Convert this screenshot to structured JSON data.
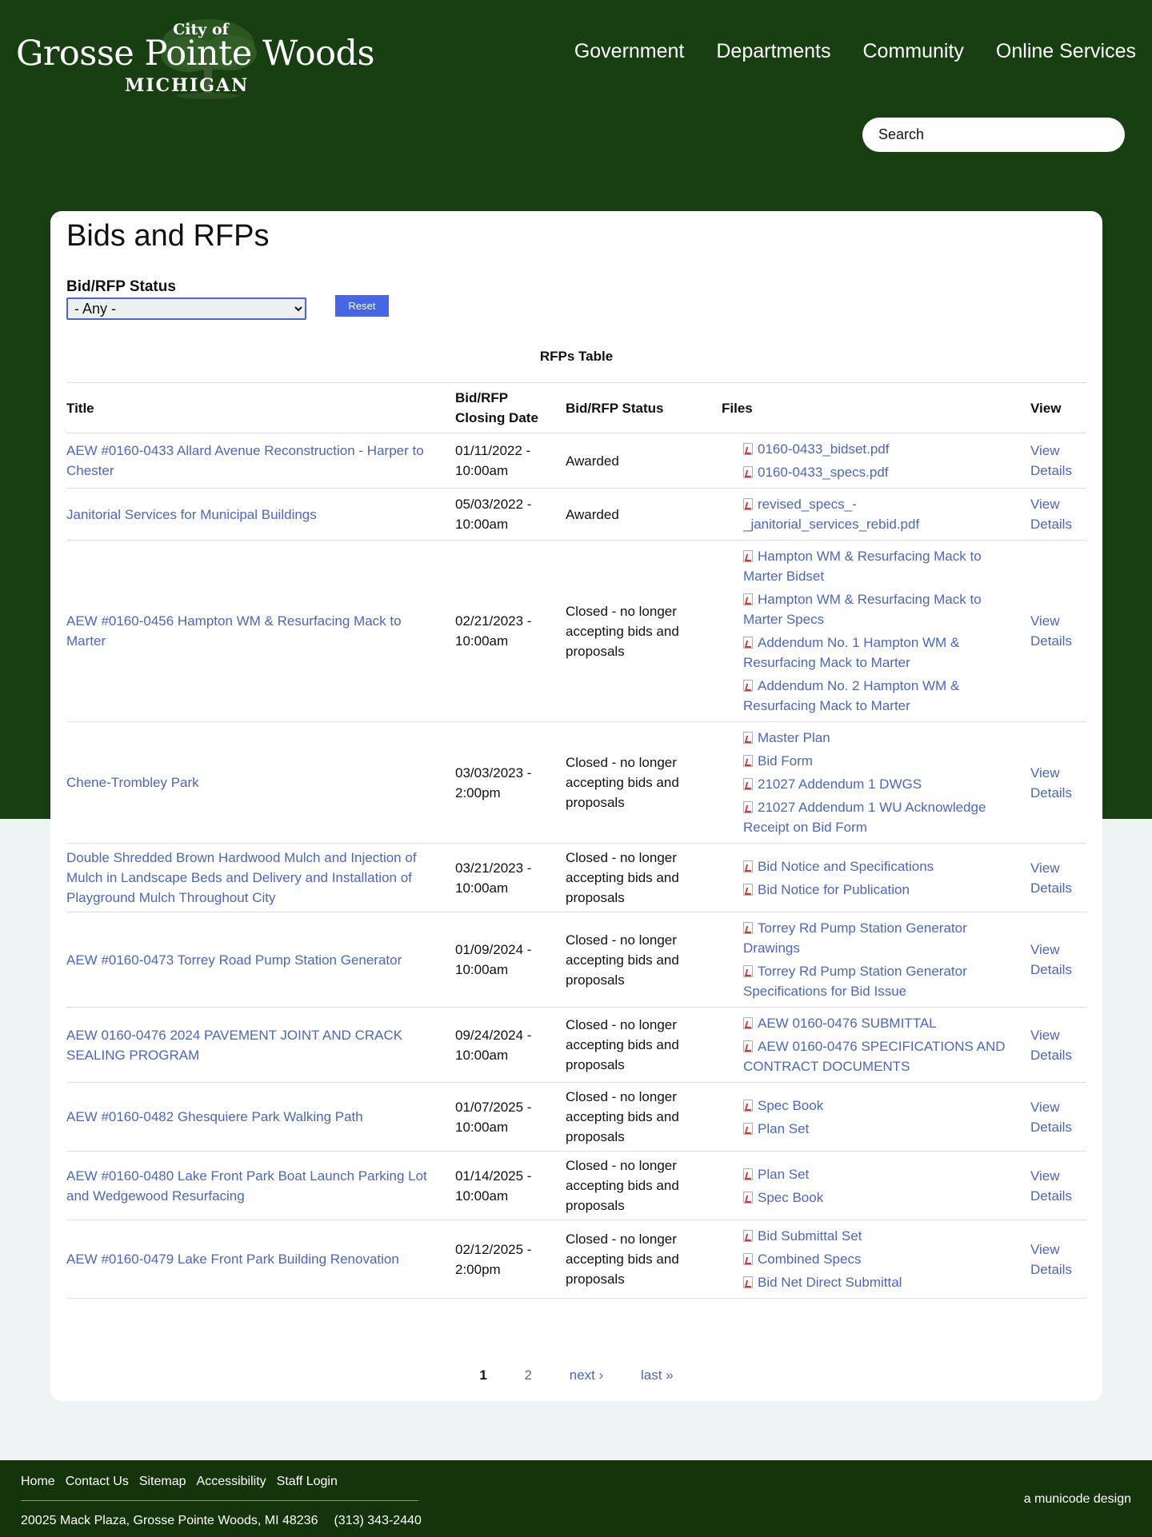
{
  "header": {
    "logo": {
      "city_of": "City of",
      "name": "Grosse Pointe Woods",
      "state": "MICHIGAN"
    },
    "nav": [
      "Government",
      "Departments",
      "Community",
      "Online Services"
    ],
    "search_placeholder": "Search"
  },
  "main": {
    "title": "Bids and RFPs",
    "filter": {
      "label": "Bid/RFP Status",
      "selected": "- Any -",
      "reset_label": "Reset"
    },
    "table": {
      "caption": "RFPs Table",
      "headers": {
        "title": "Title",
        "closing_date_1": "Bid/RFP",
        "closing_date_2": "Closing Date",
        "status": "Bid/RFP Status",
        "files": "Files",
        "view": "View"
      },
      "rows": [
        {
          "title": "AEW #0160-0433 Allard Avenue Reconstruction - Harper to Chester",
          "date": "01/11/2022 - 10:00am",
          "status": "Awarded",
          "files": [
            "0160-0433_bidset.pdf",
            "0160-0433_specs.pdf"
          ],
          "view": "View Details"
        },
        {
          "title": "Janitorial Services for Municipal Buildings",
          "date": "05/03/2022 - 10:00am",
          "status": "Awarded",
          "files": [
            "revised_specs_-_janitorial_services_rebid.pdf"
          ],
          "view": "View Details"
        },
        {
          "title": "AEW #0160-0456 Hampton WM & Resurfacing Mack to Marter",
          "date": "02/21/2023 - 10:00am",
          "status": "Closed - no longer accepting bids and proposals",
          "files": [
            "Hampton WM & Resurfacing Mack to Marter Bidset",
            "Hampton WM & Resurfacing Mack to Marter Specs",
            "Addendum No. 1 Hampton WM & Resurfacing Mack to Marter",
            "Addendum No. 2 Hampton WM & Resurfacing Mack to Marter"
          ],
          "view": "View Details"
        },
        {
          "title": "Chene-Trombley Park",
          "date": "03/03/2023 - 2:00pm",
          "status": "Closed - no longer accepting bids and proposals",
          "files": [
            "Master Plan",
            "Bid Form",
            "21027 Addendum 1 DWGS",
            "21027 Addendum 1 WU Acknowledge Receipt on Bid Form"
          ],
          "view": "View Details"
        },
        {
          "title": "Double Shredded Brown Hardwood Mulch and Injection of Mulch in Landscape Beds and Delivery and Installation of Playground Mulch Throughout City",
          "date": "03/21/2023 - 10:00am",
          "status": "Closed - no longer accepting bids and proposals",
          "files": [
            "Bid Notice and Specifications",
            "Bid Notice for Publication"
          ],
          "view": "View Details"
        },
        {
          "title": "AEW #0160-0473 Torrey Road Pump Station Generator",
          "date": "01/09/2024 - 10:00am",
          "status": "Closed - no longer accepting bids and proposals",
          "files": [
            "Torrey Rd Pump Station Generator Drawings",
            "Torrey Rd Pump Station Generator Specifications for Bid Issue"
          ],
          "view": "View Details"
        },
        {
          "title": "AEW 0160-0476 2024 PAVEMENT JOINT AND CRACK SEALING PROGRAM",
          "date": "09/24/2024 - 10:00am",
          "status": "Closed - no longer accepting bids and proposals",
          "files": [
            "AEW 0160-0476 SUBMITTAL",
            "AEW 0160-0476 SPECIFICATIONS AND CONTRACT DOCUMENTS"
          ],
          "view": "View Details"
        },
        {
          "title": "AEW #0160-0482 Ghesquiere Park Walking Path",
          "date": "01/07/2025 - 10:00am",
          "status": "Closed - no longer accepting bids and proposals",
          "files": [
            "Spec Book",
            "Plan Set"
          ],
          "view": "View Details"
        },
        {
          "title": "AEW #0160-0480 Lake Front Park Boat Launch Parking Lot and Wedgewood Resurfacing",
          "date": "01/14/2025 - 10:00am",
          "status": "Closed - no longer accepting bids and proposals",
          "files": [
            "Plan Set",
            "Spec Book"
          ],
          "view": "View Details"
        },
        {
          "title": "AEW #0160-0479 Lake Front Park Building Renovation",
          "date": "02/12/2025 - 2:00pm",
          "status": "Closed - no longer accepting bids and proposals",
          "files": [
            "Bid Submittal Set",
            "Combined Specs",
            "Bid Net Direct Submittal"
          ],
          "view": "View Details"
        }
      ]
    },
    "pager": {
      "current": "1",
      "page2": "2",
      "next": "next ›",
      "last": "last »"
    }
  },
  "footer": {
    "links": [
      "Home",
      "Contact Us",
      "Sitemap",
      "Accessibility",
      "Staff Login"
    ],
    "address": "20025 Mack Plaza, Grosse Pointe Woods, MI 48236",
    "phone": "(313) 343-2440",
    "credit": "a municode design"
  }
}
